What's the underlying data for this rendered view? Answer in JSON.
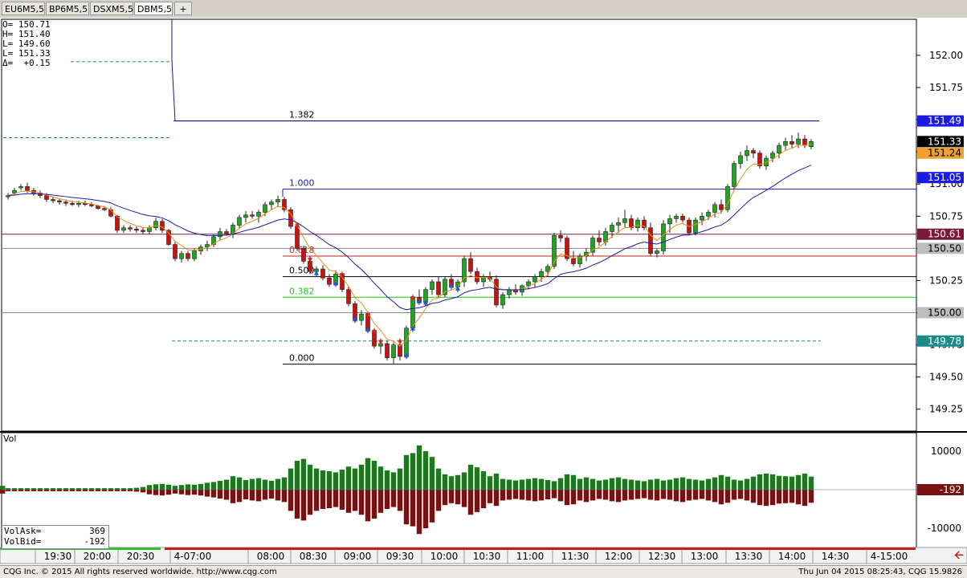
{
  "tabs": [
    {
      "label": "EU6M5,5",
      "active": false
    },
    {
      "label": "BP6M5,5",
      "active": false
    },
    {
      "label": "DSXM5,5",
      "active": false
    },
    {
      "label": "DBM5,5",
      "active": true
    }
  ],
  "add_tab_label": "+",
  "ohlc": {
    "open": "O= 150.71",
    "high": "H= 151.40",
    "low1": "L= 149.60",
    "low2": "L= 151.33",
    "delta": "Δ=  +0.15"
  },
  "volume_label": "Vol",
  "vol_box": {
    "ask_label": "VolAsk=",
    "ask_value": "369",
    "bid_label": "VolBid=",
    "bid_value": "-192"
  },
  "footer": {
    "copyright": "CQG Inc. © 2015 All rights reserved worldwide. http://www.cqg.com",
    "status": "Thu Jun 04 2015 08:25:43, CQG 15.9826"
  },
  "colors": {
    "up_candle": "#1fa51f",
    "down_candle": "#cc1010",
    "fast_ma": "#e8901a",
    "slow_ma": "#1c1cb0",
    "volume_ask": "#1b7a1b",
    "volume_bid": "#7a1010",
    "fib_line": "#1c1cb0",
    "fib_618": "#d02020",
    "fib_382": "#20c020"
  },
  "chart_data": {
    "type": "candlestick",
    "y_ticks": [
      "152.00",
      "151.75",
      "151.50",
      "151.25",
      "151.00",
      "150.75",
      "150.50",
      "150.25",
      "150.00",
      "149.75",
      "149.50",
      "149.25"
    ],
    "ylim": [
      149.08,
      152.28
    ],
    "x_ticks": [
      "19:30",
      "20:00",
      "20:30",
      "4-07:00",
      "08:00",
      "08:30",
      "09:00",
      "09:30",
      "10:00",
      "10:30",
      "11:00",
      "11:30",
      "12:00",
      "12:30",
      "13:00",
      "13:30",
      "14:00",
      "14:30",
      "4-15:00"
    ],
    "price_labels": [
      {
        "text": "151.49",
        "value": 151.49,
        "style": "blue"
      },
      {
        "text": "151.33",
        "value": 151.33,
        "style": "black"
      },
      {
        "text": "151.24",
        "value": 151.24,
        "style": "orange"
      },
      {
        "text": "151.05",
        "value": 151.05,
        "style": "blue"
      },
      {
        "text": "150.61",
        "value": 150.61,
        "style": "maroon"
      },
      {
        "text": "150.50",
        "value": 150.5,
        "style": "gray"
      },
      {
        "text": "150.00",
        "value": 150.0,
        "style": "gray"
      },
      {
        "text": "149.78",
        "value": 149.78,
        "style": "teal"
      }
    ],
    "fib_levels": [
      {
        "label": "1.382",
        "value": 151.49
      },
      {
        "label": "1.000",
        "value": 150.96
      },
      {
        "label": "0.618",
        "value": 150.44
      },
      {
        "label": "0.500",
        "value": 150.28
      },
      {
        "label": "0.382",
        "value": 150.12
      },
      {
        "label": "0.000",
        "value": 149.6
      }
    ],
    "volume_ticks": [
      "10000",
      "-192",
      "-10000"
    ],
    "candles": [
      [
        150.9,
        150.93,
        150.88,
        150.91
      ],
      [
        150.93,
        150.97,
        150.91,
        150.95
      ],
      [
        150.97,
        151.0,
        150.95,
        150.98
      ],
      [
        150.98,
        151.01,
        150.93,
        150.95
      ],
      [
        150.95,
        150.97,
        150.91,
        150.93
      ],
      [
        150.93,
        150.95,
        150.89,
        150.91
      ],
      [
        150.91,
        150.93,
        150.86,
        150.88
      ],
      [
        150.88,
        150.9,
        150.85,
        150.87
      ],
      [
        150.87,
        150.89,
        150.84,
        150.86
      ],
      [
        150.86,
        150.88,
        150.83,
        150.85
      ],
      [
        150.85,
        150.87,
        150.83,
        150.84
      ],
      [
        150.84,
        150.87,
        150.82,
        150.85
      ],
      [
        150.85,
        150.87,
        150.83,
        150.84
      ],
      [
        150.84,
        150.86,
        150.82,
        150.83
      ],
      [
        150.83,
        150.84,
        150.8,
        150.81
      ],
      [
        150.81,
        150.83,
        150.79,
        150.8
      ],
      [
        150.8,
        150.82,
        150.74,
        150.75
      ],
      [
        150.75,
        150.76,
        150.62,
        150.64
      ],
      [
        150.64,
        150.68,
        150.62,
        150.66
      ],
      [
        150.66,
        150.68,
        150.63,
        150.65
      ],
      [
        150.65,
        150.67,
        150.62,
        150.64
      ],
      [
        150.64,
        150.66,
        150.61,
        150.63
      ],
      [
        150.63,
        150.68,
        150.61,
        150.66
      ],
      [
        150.66,
        150.74,
        150.64,
        150.71
      ],
      [
        150.71,
        150.73,
        150.62,
        150.64
      ],
      [
        150.64,
        150.65,
        150.52,
        150.53
      ],
      [
        150.53,
        150.55,
        150.4,
        150.42
      ],
      [
        150.42,
        150.48,
        150.39,
        150.46
      ],
      [
        150.46,
        150.48,
        150.4,
        150.42
      ],
      [
        150.42,
        150.5,
        150.4,
        150.48
      ],
      [
        150.48,
        150.53,
        150.45,
        150.51
      ],
      [
        150.51,
        150.56,
        150.48,
        150.53
      ],
      [
        150.53,
        150.61,
        150.51,
        150.59
      ],
      [
        150.59,
        150.66,
        150.56,
        150.63
      ],
      [
        150.63,
        150.65,
        150.6,
        150.61
      ],
      [
        150.61,
        150.7,
        150.58,
        150.68
      ],
      [
        150.68,
        150.76,
        150.65,
        150.74
      ],
      [
        150.74,
        150.79,
        150.7,
        150.76
      ],
      [
        150.76,
        150.79,
        150.73,
        150.75
      ],
      [
        150.75,
        150.8,
        150.7,
        150.78
      ],
      [
        150.78,
        150.86,
        150.75,
        150.84
      ],
      [
        150.84,
        150.88,
        150.8,
        150.86
      ],
      [
        150.86,
        150.91,
        150.82,
        150.88
      ],
      [
        150.88,
        150.9,
        150.78,
        150.8
      ],
      [
        150.8,
        150.82,
        150.65,
        150.67
      ],
      [
        150.67,
        150.7,
        150.48,
        150.5
      ],
      [
        150.5,
        150.52,
        150.38,
        150.4
      ],
      [
        150.4,
        150.44,
        150.3,
        150.32
      ],
      [
        150.32,
        150.36,
        150.28,
        150.34
      ],
      [
        150.34,
        150.37,
        150.25,
        150.27
      ],
      [
        150.27,
        150.3,
        150.2,
        150.22
      ],
      [
        150.22,
        150.33,
        150.2,
        150.3
      ],
      [
        150.3,
        150.32,
        150.16,
        150.18
      ],
      [
        150.18,
        150.2,
        150.05,
        150.07
      ],
      [
        150.07,
        150.09,
        149.92,
        149.94
      ],
      [
        149.94,
        150.02,
        149.9,
        149.99
      ],
      [
        149.99,
        150.01,
        149.84,
        149.86
      ],
      [
        149.86,
        149.88,
        149.72,
        149.74
      ],
      [
        149.74,
        149.8,
        149.68,
        149.76
      ],
      [
        149.76,
        149.78,
        149.63,
        149.65
      ],
      [
        149.65,
        149.77,
        149.6,
        149.75
      ],
      [
        149.75,
        149.8,
        149.63,
        149.66
      ],
      [
        149.66,
        149.9,
        149.64,
        149.88
      ],
      [
        149.88,
        150.14,
        149.85,
        150.12
      ],
      [
        150.12,
        150.18,
        150.06,
        150.08
      ],
      [
        150.08,
        150.2,
        150.05,
        150.18
      ],
      [
        150.18,
        150.26,
        150.14,
        150.24
      ],
      [
        150.24,
        150.28,
        150.12,
        150.14
      ],
      [
        150.14,
        150.28,
        150.12,
        150.26
      ],
      [
        150.26,
        150.3,
        150.18,
        150.2
      ],
      [
        150.2,
        150.26,
        150.16,
        150.24
      ],
      [
        150.24,
        150.44,
        150.2,
        150.42
      ],
      [
        150.42,
        150.47,
        150.3,
        150.32
      ],
      [
        150.32,
        150.35,
        150.22,
        150.24
      ],
      [
        150.24,
        150.3,
        150.2,
        150.28
      ],
      [
        150.28,
        150.32,
        150.24,
        150.26
      ],
      [
        150.26,
        150.29,
        150.04,
        150.06
      ],
      [
        150.06,
        150.16,
        150.03,
        150.14
      ],
      [
        150.14,
        150.2,
        150.11,
        150.18
      ],
      [
        150.18,
        150.22,
        150.14,
        150.16
      ],
      [
        150.16,
        150.22,
        150.13,
        150.21
      ],
      [
        150.21,
        150.26,
        150.18,
        150.24
      ],
      [
        150.24,
        150.3,
        150.2,
        150.28
      ],
      [
        150.28,
        150.34,
        150.24,
        150.32
      ],
      [
        150.32,
        150.38,
        150.28,
        150.36
      ],
      [
        150.36,
        150.62,
        150.34,
        150.6
      ],
      [
        150.6,
        150.64,
        150.55,
        150.58
      ],
      [
        150.58,
        150.6,
        150.4,
        150.42
      ],
      [
        150.42,
        150.48,
        150.36,
        150.38
      ],
      [
        150.38,
        150.46,
        150.35,
        150.44
      ],
      [
        150.44,
        150.5,
        150.4,
        150.47
      ],
      [
        150.47,
        150.6,
        150.44,
        150.58
      ],
      [
        150.58,
        150.64,
        150.52,
        150.55
      ],
      [
        150.55,
        150.66,
        150.52,
        150.63
      ],
      [
        150.63,
        150.7,
        150.58,
        150.68
      ],
      [
        150.68,
        150.74,
        150.62,
        150.7
      ],
      [
        150.7,
        150.8,
        150.66,
        150.73
      ],
      [
        150.73,
        150.76,
        150.64,
        150.66
      ],
      [
        150.66,
        150.74,
        150.63,
        150.72
      ],
      [
        150.72,
        150.75,
        150.64,
        150.66
      ],
      [
        150.66,
        150.7,
        150.44,
        150.46
      ],
      [
        150.46,
        150.5,
        150.43,
        150.48
      ],
      [
        150.48,
        150.72,
        150.45,
        150.69
      ],
      [
        150.69,
        150.76,
        150.62,
        150.73
      ],
      [
        150.73,
        150.77,
        150.7,
        150.75
      ],
      [
        150.75,
        150.77,
        150.7,
        150.72
      ],
      [
        150.72,
        150.74,
        150.6,
        150.62
      ],
      [
        150.62,
        150.74,
        150.6,
        150.72
      ],
      [
        150.72,
        150.78,
        150.68,
        150.75
      ],
      [
        150.75,
        150.8,
        150.72,
        150.78
      ],
      [
        150.78,
        150.86,
        150.74,
        150.84
      ],
      [
        150.84,
        150.88,
        150.77,
        150.8
      ],
      [
        150.8,
        151.0,
        150.78,
        150.98
      ],
      [
        150.98,
        151.18,
        150.95,
        151.16
      ],
      [
        151.16,
        151.25,
        151.12,
        151.22
      ],
      [
        151.22,
        151.3,
        151.18,
        151.26
      ],
      [
        151.26,
        151.28,
        151.2,
        151.24
      ],
      [
        151.24,
        151.26,
        151.12,
        151.14
      ],
      [
        151.14,
        151.22,
        151.11,
        151.2
      ],
      [
        151.2,
        151.26,
        151.17,
        151.24
      ],
      [
        151.24,
        151.32,
        151.2,
        151.3
      ],
      [
        151.3,
        151.36,
        151.26,
        151.33
      ],
      [
        151.33,
        151.38,
        151.28,
        151.31
      ],
      [
        151.31,
        151.4,
        151.28,
        151.35
      ],
      [
        151.35,
        151.38,
        151.28,
        151.3
      ],
      [
        151.29,
        151.35,
        151.27,
        151.33
      ]
    ],
    "volume_ask": [
      400,
      400,
      400,
      400,
      400,
      400,
      400,
      400,
      400,
      400,
      400,
      400,
      400,
      400,
      400,
      400,
      400,
      400,
      400,
      400,
      500,
      700,
      1200,
      1400,
      1500,
      1300,
      1000,
      1200,
      1400,
      1300,
      1500,
      1800,
      2000,
      2300,
      2600,
      3500,
      3200,
      2500,
      2800,
      3000,
      2600,
      2300,
      2800,
      3200,
      5500,
      7500,
      8000,
      6500,
      5500,
      5000,
      4800,
      4500,
      5200,
      6000,
      5500,
      6500,
      8200,
      7500,
      6000,
      5000,
      4500,
      5500,
      9000,
      9500,
      11500,
      10000,
      8500,
      5500,
      4000,
      3500,
      3800,
      4500,
      6500,
      5800,
      4800,
      3500,
      4200,
      2800,
      2600,
      2400,
      2600,
      2800,
      3000,
      2800,
      2500,
      2200,
      3000,
      4000,
      3800,
      2800,
      3200,
      2800,
      2400,
      2600,
      3000,
      3200,
      2800,
      2600,
      2400,
      2200,
      2600,
      2800,
      2400,
      2600,
      3000,
      3200,
      2800,
      2600,
      2400,
      2800,
      3200,
      3800,
      3400,
      2600,
      2400,
      2800,
      3400,
      4000,
      4200,
      4000,
      3600,
      3500,
      3400,
      3800,
      4200,
      3400,
      1000
    ],
    "volume_bid": [
      -400,
      -400,
      -400,
      -400,
      -400,
      -400,
      -400,
      -400,
      -400,
      -400,
      -400,
      -400,
      -400,
      -400,
      -400,
      -400,
      -400,
      -400,
      -400,
      -400,
      -500,
      -700,
      -1200,
      -1400,
      -1500,
      -1300,
      -1000,
      -1200,
      -1400,
      -1300,
      -1500,
      -1800,
      -2000,
      -2300,
      -2600,
      -3500,
      -3200,
      -2500,
      -2800,
      -3000,
      -2600,
      -2300,
      -2800,
      -3200,
      -5500,
      -7500,
      -8000,
      -6500,
      -5500,
      -5000,
      -4800,
      -4500,
      -5200,
      -6000,
      -5500,
      -6500,
      -8200,
      -7500,
      -6000,
      -5000,
      -4500,
      -5500,
      -9000,
      -9500,
      -11500,
      -10000,
      -8500,
      -5500,
      -4000,
      -3500,
      -3800,
      -4500,
      -6500,
      -5800,
      -4800,
      -3500,
      -4200,
      -2800,
      -2600,
      -2400,
      -2600,
      -2800,
      -3000,
      -2800,
      -2500,
      -2200,
      -3000,
      -4000,
      -3800,
      -2800,
      -3200,
      -2800,
      -2400,
      -2600,
      -3000,
      -3200,
      -2800,
      -2600,
      -2400,
      -2200,
      -2600,
      -2800,
      -2400,
      -2600,
      -3000,
      -3200,
      -2800,
      -2600,
      -2400,
      -2800,
      -3200,
      -3800,
      -3400,
      -2600,
      -2400,
      -2800,
      -3400,
      -4000,
      -4200,
      -4000,
      -3600,
      -3500,
      -3400,
      -3800,
      -4200,
      -3400,
      -1000
    ],
    "horizontal_lines": [
      {
        "value": 151.49,
        "style": "navy"
      },
      {
        "value": 150.61,
        "style": "maroon"
      },
      {
        "value": 150.5,
        "style": "gray"
      },
      {
        "value": 150.0,
        "style": "gray"
      },
      {
        "value": 149.78,
        "style": "teal-dash"
      },
      {
        "value": 151.36,
        "style": "green-dash"
      },
      {
        "value": 151.95,
        "style": "teal-dash"
      }
    ],
    "grid": false,
    "legend": "none"
  }
}
